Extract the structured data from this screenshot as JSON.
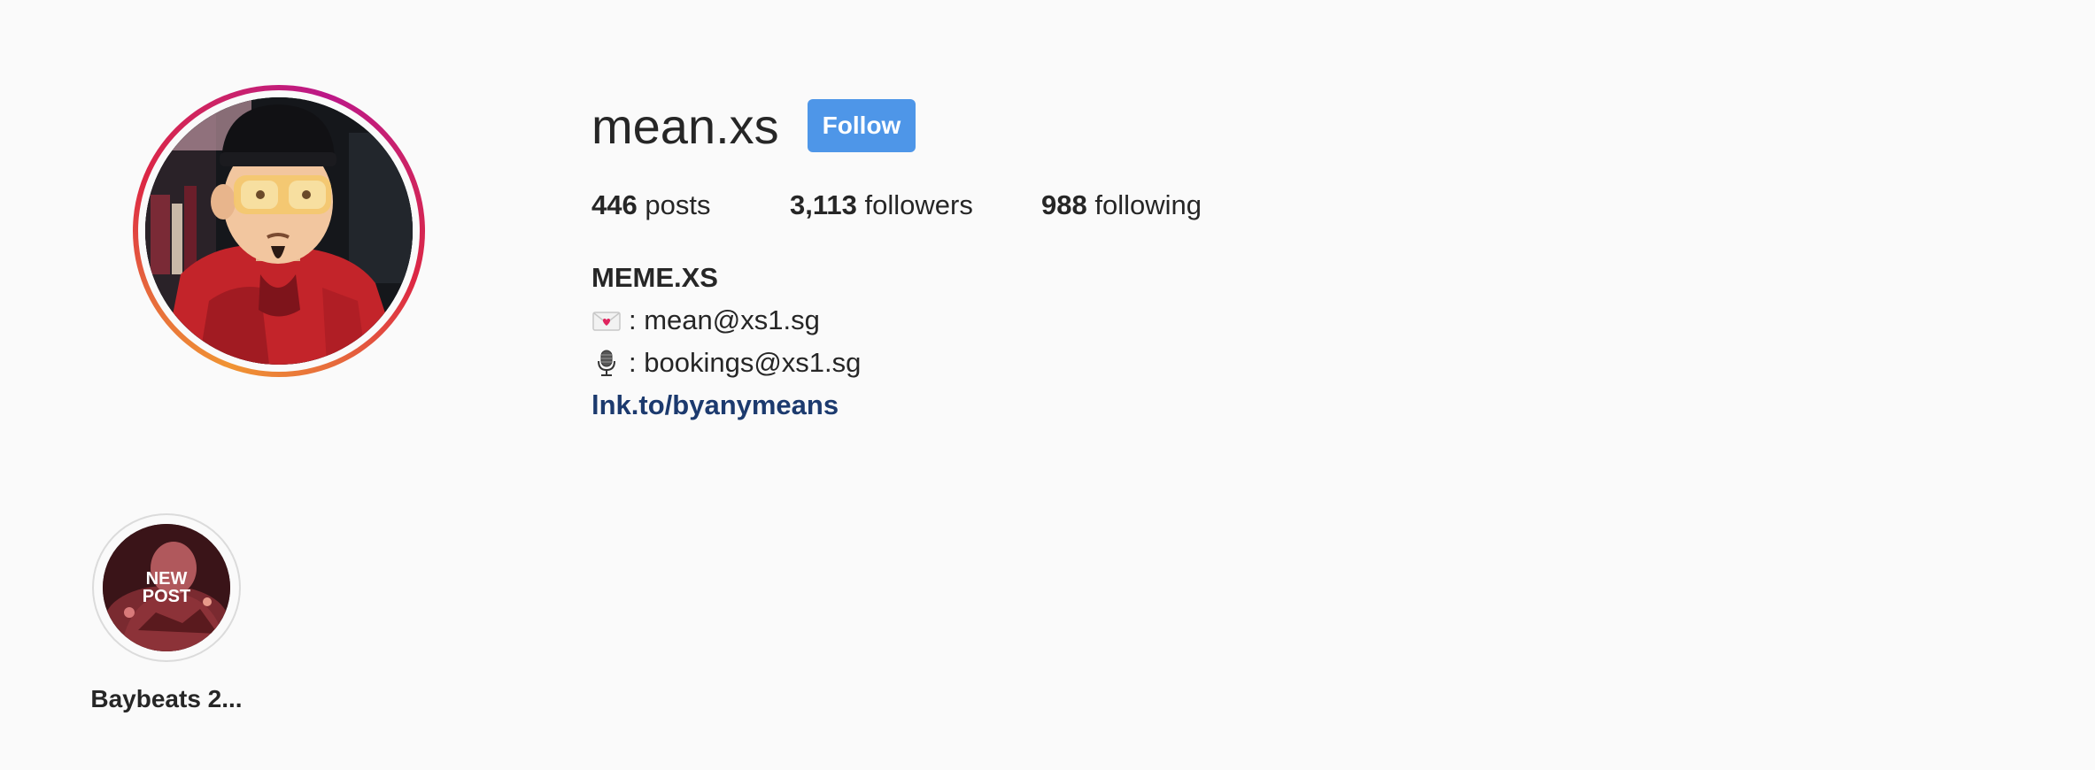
{
  "profile": {
    "username": "mean.xs",
    "follow_label": "Follow"
  },
  "stats": {
    "posts_count": "446",
    "posts_label": "posts",
    "followers_count": "3,113",
    "followers_label": "followers",
    "following_count": "988",
    "following_label": "following"
  },
  "bio": {
    "full_name": "MEME.XS",
    "email_line": ": mean@xs1.sg",
    "email_icon": "love-letter-icon",
    "bookings_line": ": bookings@xs1.sg",
    "bookings_icon": "microphone-icon",
    "link": "lnk.to/byanymeans"
  },
  "highlights": [
    {
      "label": "Baybeats 2...",
      "cover_text": [
        "NEW",
        "POST"
      ]
    }
  ],
  "colors": {
    "background": "#fafafa",
    "text": "#262626",
    "follow_button": "#4e96e8",
    "link": "#1c3a6e"
  }
}
